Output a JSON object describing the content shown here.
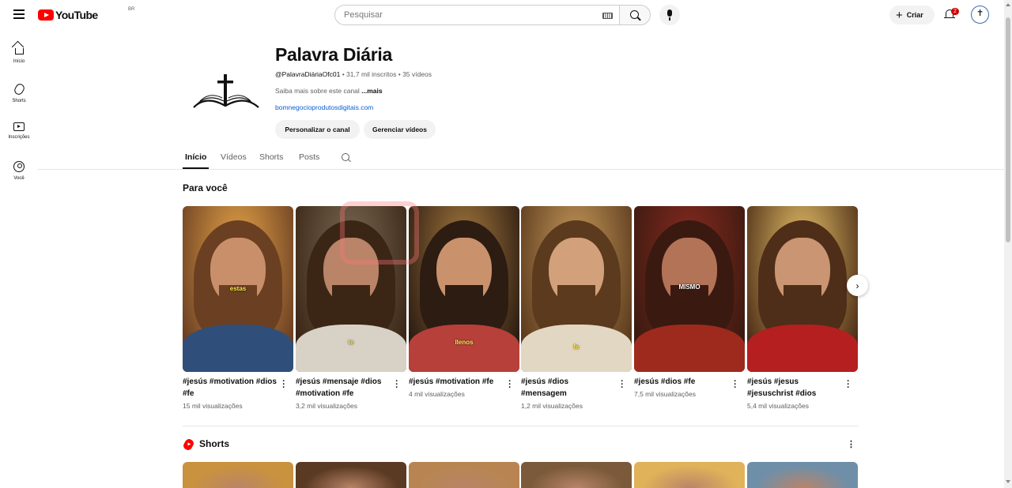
{
  "header": {
    "logo_text": "YouTube",
    "country_code": "BR",
    "search_placeholder": "Pesquisar",
    "create_label": "Criar",
    "notification_count": "2"
  },
  "sidebar": {
    "items": [
      {
        "label": "Início",
        "icon": "home-icon"
      },
      {
        "label": "Shorts",
        "icon": "shorts-icon"
      },
      {
        "label": "Inscrições",
        "icon": "subscriptions-icon"
      },
      {
        "label": "Você",
        "icon": "you-icon"
      }
    ]
  },
  "channel": {
    "name": "Palavra Diária",
    "handle": "@PalavraDiáriaOfc01",
    "subscribers": "31,7 mil inscritos",
    "video_count": "35 vídeos",
    "description": "Saiba mais sobre este canal",
    "more_label": "...mais",
    "link": "bomnegocioprodutosdigitais.com",
    "customize_label": "Personalizar o canal",
    "manage_label": "Gerenciar vídeos"
  },
  "tabs": [
    {
      "label": "Início",
      "active": true
    },
    {
      "label": "Vídeos",
      "active": false
    },
    {
      "label": "Shorts",
      "active": false
    },
    {
      "label": "Posts",
      "active": false
    }
  ],
  "for_you": {
    "title": "Para você",
    "videos": [
      {
        "title": "#jesús #motivation #dios #fe",
        "views": "15 mil visualizações",
        "caption": "estas",
        "palette": [
          "#e8a64a",
          "#6b3f22",
          "#c98f6a",
          "#2f4f7a"
        ]
      },
      {
        "title": "#jesús #mensaje #dios #motivation #fe",
        "views": "3,2 mil visualizações",
        "caption": "te",
        "palette": [
          "#7a6a55",
          "#3b2616",
          "#b98468",
          "#d8d2c6"
        ]
      },
      {
        "title": "#jesús #motivation #fe",
        "views": "4 mil visualizações",
        "caption": "llenos",
        "palette": [
          "#a77b3f",
          "#2c1c12",
          "#c9926c",
          "#b7403a"
        ]
      },
      {
        "title": "#jesús #dios #mensagem",
        "views": "1,2 mil visualizações",
        "caption": "fe",
        "palette": [
          "#c79a5b",
          "#5b3a1d",
          "#d2a07a",
          "#e2d7c2"
        ]
      },
      {
        "title": "#jesús #dios #fe",
        "views": "7,5 mil visualizações",
        "caption": "MISMO",
        "palette": [
          "#8a2a20",
          "#3a1a10",
          "#b37356",
          "#9e2a1e"
        ]
      },
      {
        "title": "#jesús #jesus #jesuschrist #dios",
        "views": "5,4 mil visualizações",
        "caption": "",
        "palette": [
          "#e8c46a",
          "#4e2e18",
          "#c99572",
          "#b51f1f"
        ]
      }
    ]
  },
  "shorts_section": {
    "title": "Shorts",
    "palettes": [
      "#c9923f",
      "#5a3a22",
      "#b88552",
      "#7a5a3a",
      "#e0b25a",
      "#6f8fa8"
    ]
  },
  "colors": {
    "brand_red": "#ff0000",
    "link_blue": "#065fd4",
    "badge_red": "#cc0000"
  }
}
